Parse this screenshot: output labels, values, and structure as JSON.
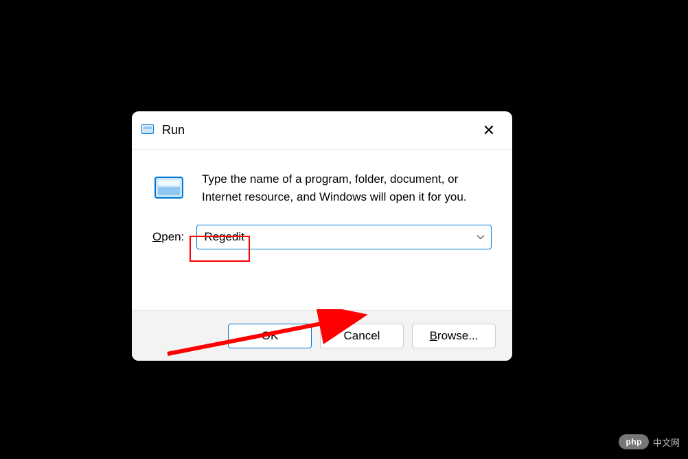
{
  "dialog": {
    "title": "Run",
    "description": "Type the name of a program, folder, document, or Internet resource, and Windows will open it for you.",
    "open_label_prefix": "O",
    "open_label_rest": "pen:",
    "input_value": "Regedit",
    "buttons": {
      "ok": "OK",
      "cancel": "Cancel",
      "browse_prefix": "B",
      "browse_rest": "rowse..."
    }
  },
  "watermark": {
    "logo": "php",
    "text": "中文网"
  }
}
